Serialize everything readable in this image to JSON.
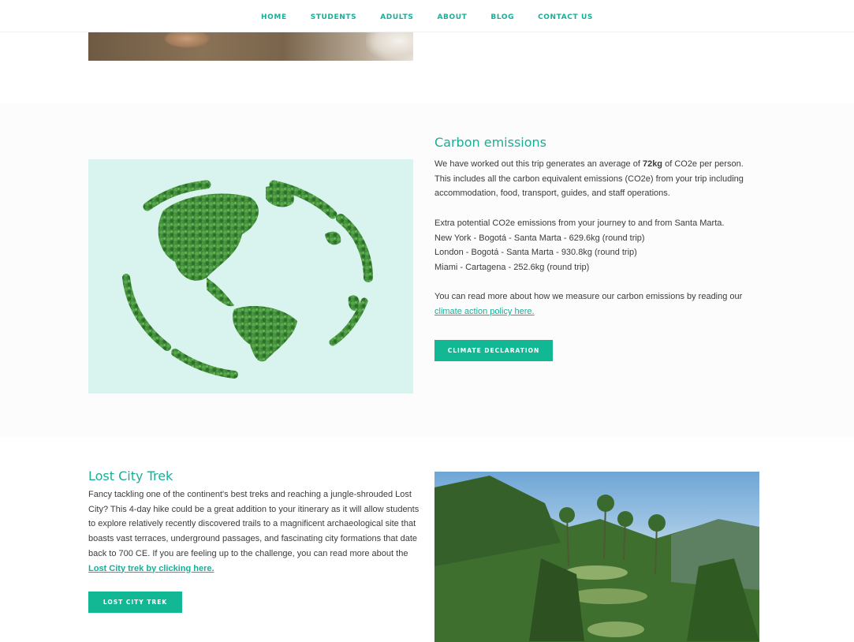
{
  "nav": {
    "items": [
      "HOME",
      "STUDENTS",
      "ADULTS",
      "ABOUT",
      "BLOG",
      "CONTACT US"
    ]
  },
  "carbon": {
    "title": "Carbon emissions",
    "p1_prefix": "We have worked out this trip generates an average of ",
    "p1_bold": "72kg",
    "p1_suffix": " of CO2e per person. This includes all the carbon equivalent emissions (CO2e) from your trip including accommodation, food, transport, guides, and staff operations.",
    "extra_heading": "Extra potential CO2e emissions from your journey to and from Santa Marta.",
    "routes": [
      "New York - Bogotá - Santa Marta - 629.6kg (round trip)",
      "London - Bogotá - Santa Marta - 930.8kg (round trip)",
      "Miami - Cartagena - 252.6kg (round trip)"
    ],
    "read_more": "You can read more about how we measure our carbon emissions by reading our",
    "link": "climate action policy here. ",
    "button": "CLIMATE DECLARATION"
  },
  "lost_city": {
    "title": "Lost City Trek",
    "body": "Fancy tackling one of the continent's best treks and reaching a jungle-shrouded Lost City? This 4-day hike could be a great addition to your itinerary as it will allow students to explore relatively recently discovered trails to a magnificent archaeological site that boasts vast terraces, underground passages, and fascinating city formations that date back to 700 CE. If you are feeling up to the challenge, you can read more about the ",
    "link": "Lost City trek by clicking here.",
    "button": "LOST CITY TREK"
  },
  "colors": {
    "accent": "#1aae96",
    "button": "#12b894",
    "band": "#fcfcfc"
  }
}
